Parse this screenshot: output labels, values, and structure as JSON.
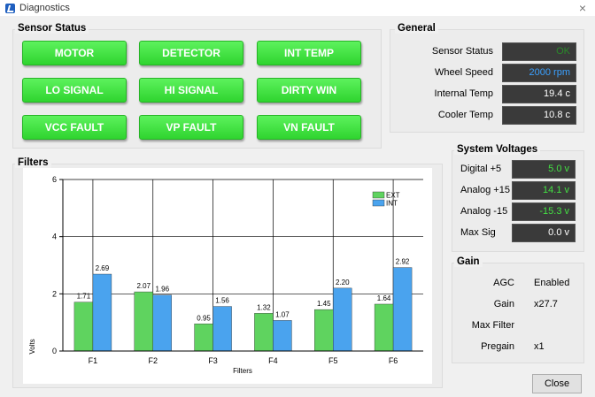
{
  "window": {
    "title": "Diagnostics",
    "close_glyph": "×"
  },
  "sensor_status": {
    "title": "Sensor Status",
    "buttons": [
      "MOTOR",
      "DETECTOR",
      "INT TEMP",
      "LO SIGNAL",
      "HI SIGNAL",
      "DIRTY WIN",
      "VCC FAULT",
      "VP FAULT",
      "VN FAULT"
    ],
    "color": "#3ee23e"
  },
  "general": {
    "title": "General",
    "rows": [
      {
        "label": "Sensor Status",
        "value": "OK",
        "color": "#2a8a2a"
      },
      {
        "label": "Wheel Speed",
        "value": "2000 rpm",
        "color": "#3aa0ff"
      },
      {
        "label": "Internal Temp",
        "value": "19.4 c",
        "color": "#ffffff"
      },
      {
        "label": "Cooler Temp",
        "value": "10.8 c",
        "color": "#ffffff"
      }
    ]
  },
  "system_voltages": {
    "title": "System Voltages",
    "rows": [
      {
        "label": "Digital +5",
        "value": "5.0 v",
        "color": "#43e043"
      },
      {
        "label": "Analog +15",
        "value": "14.1 v",
        "color": "#43e043"
      },
      {
        "label": "Analog -15",
        "value": "-15.3 v",
        "color": "#43e043"
      },
      {
        "label": "Max Sig",
        "value": "0.0 v",
        "color": "#ffffff"
      }
    ]
  },
  "gain": {
    "title": "Gain",
    "rows": [
      {
        "label": "AGC",
        "value": "Enabled"
      },
      {
        "label": "Gain",
        "value": "x27.7"
      },
      {
        "label": "Max Filter",
        "value": ""
      },
      {
        "label": "Pregain",
        "value": "x1"
      }
    ]
  },
  "filters": {
    "title": "Filters"
  },
  "close_button": "Close",
  "chart_data": {
    "type": "bar",
    "categories": [
      "F1",
      "F2",
      "F3",
      "F4",
      "F5",
      "F6"
    ],
    "series": [
      {
        "name": "EXT",
        "values": [
          1.71,
          2.07,
          0.95,
          1.32,
          1.45,
          1.64
        ],
        "value_labels": [
          "1.71",
          "2.07",
          "0.95",
          "1.32",
          "1.45",
          "1.64"
        ],
        "color": "#5fd35f"
      },
      {
        "name": "INT",
        "values": [
          2.69,
          1.96,
          1.56,
          1.07,
          2.2,
          2.92
        ],
        "value_labels": [
          "2.69",
          "1.96",
          "1.56",
          "1.07",
          "2.20",
          "2.92"
        ],
        "color": "#4aa3ee"
      }
    ],
    "xlabel": "Filters",
    "ylabel": "Volts",
    "ylim": [
      0,
      6
    ],
    "yticks": [
      "0",
      "2",
      "4",
      "6"
    ],
    "grid": true,
    "legend_position": "top-right"
  }
}
